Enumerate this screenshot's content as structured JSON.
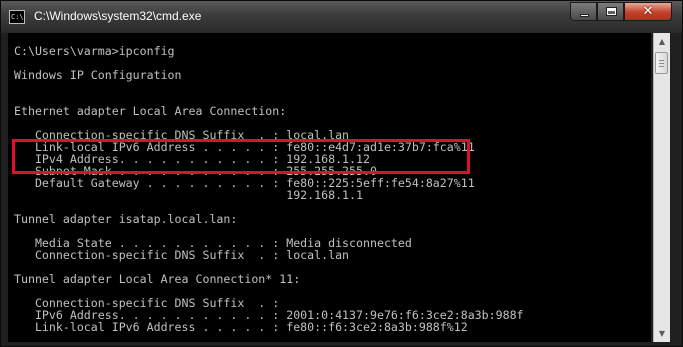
{
  "window": {
    "title": "C:\\Windows\\system32\\cmd.exe",
    "icon_text": "C:\\",
    "minimize_icon": "minimize-icon",
    "maximize_icon": "maximize-icon",
    "close_icon": "close-icon",
    "close_glyph": "✕"
  },
  "scrollbar": {
    "up_glyph": "▲",
    "down_glyph": "▼"
  },
  "console": {
    "lines": [
      "C:\\Users\\varma>ipconfig",
      "",
      "Windows IP Configuration",
      "",
      "",
      "Ethernet adapter Local Area Connection:",
      "",
      "   Connection-specific DNS Suffix  . : local.lan",
      "   Link-local IPv6 Address . . . . . : fe80::e4d7:ad1e:37b7:fca%11",
      "   IPv4 Address. . . . . . . . . . . : 192.168.1.12",
      "   Subnet Mask . . . . . . . . . . . : 255.255.255.0",
      "   Default Gateway . . . . . . . . . : fe80::225:5eff:fe54:8a27%11",
      "                                       192.168.1.1",
      "",
      "Tunnel adapter isatap.local.lan:",
      "",
      "   Media State . . . . . . . . . . . : Media disconnected",
      "   Connection-specific DNS Suffix  . : local.lan",
      "",
      "Tunnel adapter Local Area Connection* 11:",
      "",
      "   Connection-specific DNS Suffix  . :",
      "   IPv6 Address. . . . . . . . . . . : 2001:0:4137:9e76:f6:3ce2:8a3b:988f",
      "   Link-local IPv6 Address . . . . . : fe80::f6:3ce2:8a3b:988f%12"
    ]
  },
  "colors": {
    "console_bg": "#000000",
    "console_text": "#c0c0c0",
    "highlight_border": "#e0102b",
    "close_button": "#c4412b"
  }
}
